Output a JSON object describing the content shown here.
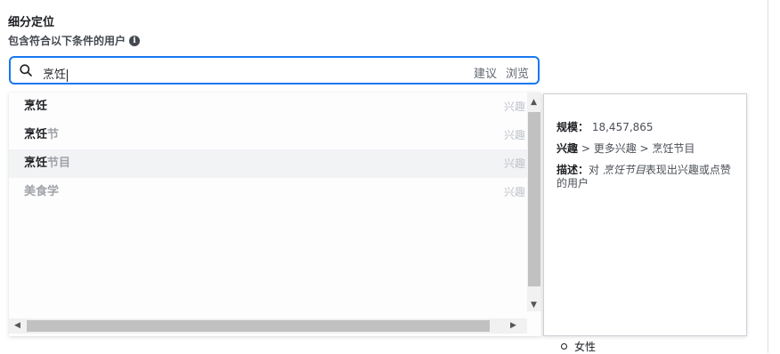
{
  "section": {
    "title": "细分定位",
    "subtitle": "包含符合以下条件的用户"
  },
  "search": {
    "value": "烹饪",
    "suggest_label": "建议",
    "browse_label": "浏览"
  },
  "options": [
    {
      "match": "烹饪",
      "rest": "",
      "category": "兴趣"
    },
    {
      "match": "烹饪",
      "rest": "节",
      "category": "兴趣"
    },
    {
      "match": "烹饪",
      "rest": "节目",
      "category": "兴趣"
    },
    {
      "match": "美食学",
      "rest": "",
      "category": "兴趣"
    }
  ],
  "tooltip": {
    "size_label": "规模：",
    "size_value": "18,457,865",
    "interest_label": "兴趣",
    "interest_path": " > 更多兴趣 > 烹饪节目",
    "desc_label": "描述：",
    "desc_prefix": "对 ",
    "desc_italic": "烹饪节目",
    "desc_suffix": "表现出兴趣或点赞的用户"
  },
  "behind": {
    "gender_item": "女性"
  }
}
